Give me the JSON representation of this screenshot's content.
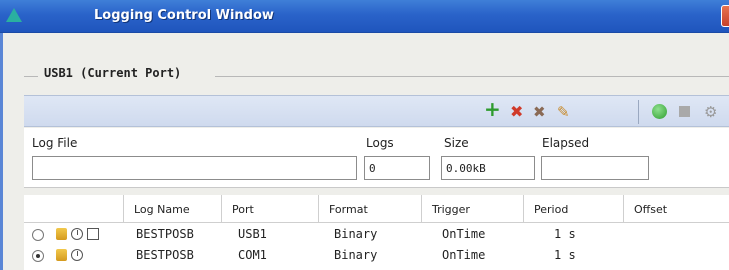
{
  "window": {
    "title": "Logging Control Window"
  },
  "port_group": {
    "title": "USB1 (Current Port)"
  },
  "toolbar": {
    "add_icon": "plus-icon",
    "remove_icon": "x-icon",
    "remove_all_icon": "remove-all-icon",
    "edit_icon": "pencil-icon",
    "start_icon": "green-circle-icon",
    "stop_icon": "stop-square-icon",
    "settings_icon": "gear-icon"
  },
  "fields": {
    "log_file_label": "Log File",
    "log_file_value": "",
    "logs_label": "Logs",
    "logs_value": "0",
    "size_label": "Size",
    "size_value": "0.00kB",
    "elapsed_label": "Elapsed",
    "elapsed_value": ""
  },
  "table": {
    "headers": [
      "Log Name",
      "Port",
      "Format",
      "Trigger",
      "Period",
      "Offset"
    ],
    "rows": [
      {
        "selected": false,
        "log_name": "BESTPOSB",
        "port": "USB1",
        "format": "Binary",
        "trigger": "OnTime",
        "period": "1 s"
      },
      {
        "selected": true,
        "log_name": "BESTPOSB",
        "port": "COM1",
        "format": "Binary",
        "trigger": "OnTime",
        "period": "1 s"
      }
    ]
  },
  "colors": {
    "titlebar": "#2a63c9",
    "add_green": "#2e9b2e",
    "remove_red": "#d03a2a",
    "start_green": "#3cae3c"
  }
}
